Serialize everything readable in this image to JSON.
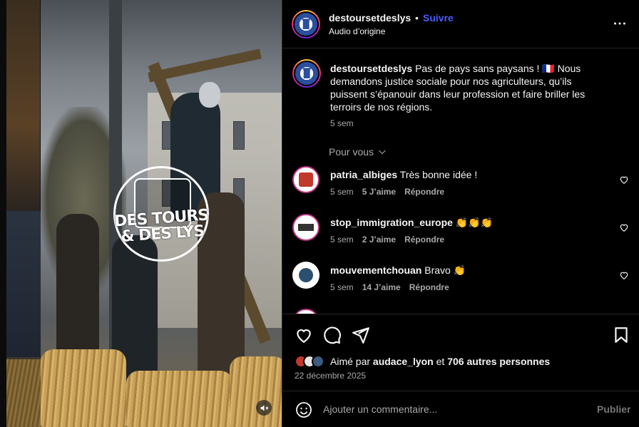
{
  "post": {
    "username": "destoursetdeslys",
    "follow_label": "Suivre",
    "separator": "•",
    "audio": "Audio d’origine",
    "media_logo_line1": "DES TOURS",
    "media_logo_line2": "& DES LYS"
  },
  "caption": {
    "username": "destoursetdeslys",
    "text": "Pas de pays sans paysans ! 🇫🇷 Nous demandons justice sociale pour nos agriculteurs, qu’ils puissent s’épanouir dans leur profession et faire briller les terroirs de nos régions.",
    "time": "5 sem"
  },
  "for_you": {
    "label": "Pour vous"
  },
  "comments": [
    {
      "username": "patria_albiges",
      "text": "Très bonne idée !",
      "time": "5 sem",
      "likes": "5 J’aime",
      "reply": "Répondre",
      "avatar_color": "#c0392b"
    },
    {
      "username": "stop_immigration_europe",
      "text": "👏👏👏",
      "time": "5 sem",
      "likes": "2 J’aime",
      "reply": "Répondre",
      "avatar_color": "#ffffff"
    },
    {
      "username": "mouvementchouan",
      "text": "Bravo 👏",
      "time": "5 sem",
      "likes": "14 J’aime",
      "reply": "Répondre",
      "avatar_color": "#ffffff"
    },
    {
      "username": "...",
      "text": "",
      "time": "",
      "likes": "",
      "reply": "",
      "avatar_color": "#c0392b"
    }
  ],
  "likes": {
    "prefix": "Aimé par",
    "user": "audace_lyon",
    "connector": "et",
    "others": "706 autres personnes"
  },
  "date": "22 décembre 2025",
  "add_comment": {
    "placeholder": "Ajouter un commentaire...",
    "publish": "Publier"
  }
}
